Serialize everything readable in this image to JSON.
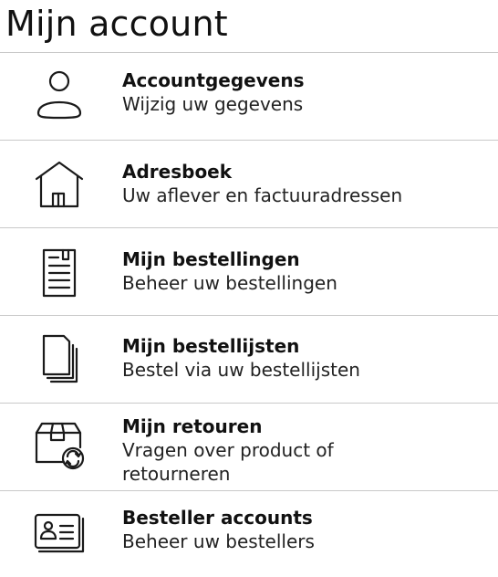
{
  "page": {
    "title": "Mijn account"
  },
  "menu": {
    "items": [
      {
        "key": "accountgegevens",
        "icon": "user-icon",
        "title": "Accountgegevens",
        "subtitle": "Wijzig uw gegevens"
      },
      {
        "key": "adresboek",
        "icon": "house-icon",
        "title": "Adresboek",
        "subtitle": "Uw aflever en factuuradressen"
      },
      {
        "key": "bestellingen",
        "icon": "document-icon",
        "title": "Mijn bestellingen",
        "subtitle": "Beheer uw bestellingen"
      },
      {
        "key": "bestellijsten",
        "icon": "stacked-documents-icon",
        "title": "Mijn bestellijsten",
        "subtitle": "Bestel via uw bestellijsten"
      },
      {
        "key": "retouren",
        "icon": "package-return-icon",
        "title": "Mijn retouren",
        "subtitle": "Vragen over product of\nretourneren"
      },
      {
        "key": "besteller-accounts",
        "icon": "id-card-icon",
        "title": "Besteller accounts",
        "subtitle": "Beheer uw bestellers"
      }
    ]
  }
}
